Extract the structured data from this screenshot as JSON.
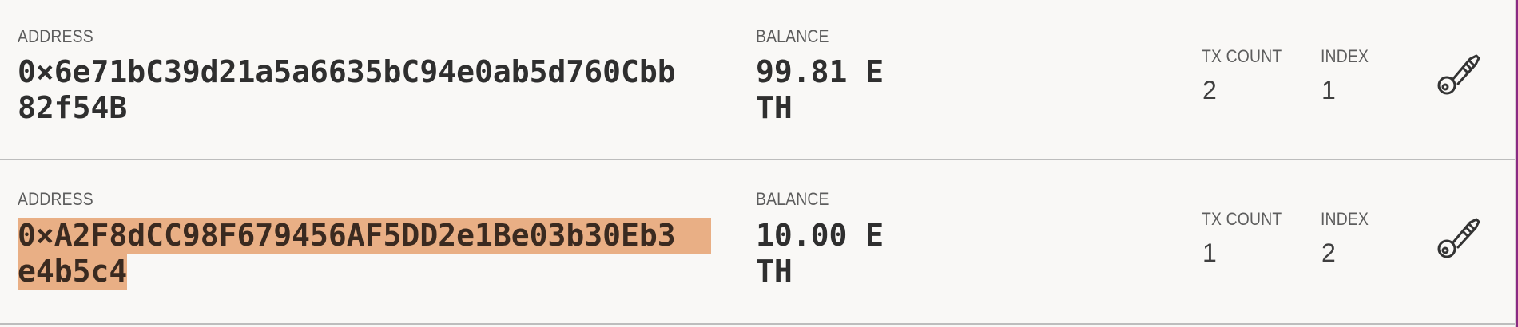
{
  "accounts": [
    {
      "address_label": "ADDRESS",
      "address_line1": "0×6e71bC39d21a5a6635bC94e0ab5d760Cbb",
      "address_line2": "82f54B",
      "balance_label": "BALANCE",
      "balance_line1": "99.81 E",
      "balance_line2": "TH",
      "tx_count_label": "TX COUNT",
      "tx_count": "2",
      "index_label": "INDEX",
      "index": "1",
      "key_icon": "key-icon",
      "selected": false
    },
    {
      "address_label": "ADDRESS",
      "address_line1": "0×A2F8dCC98F679456AF5DD2e1Be03b30Eb3",
      "address_line2": "e4b5c4",
      "balance_label": "BALANCE",
      "balance_line1": "10.00 E",
      "balance_line2": "TH",
      "tx_count_label": "TX COUNT",
      "tx_count": "1",
      "index_label": "INDEX",
      "index": "2",
      "key_icon": "key-icon",
      "selected": true
    }
  ],
  "colors": {
    "background": "#f9f8f6",
    "selection_highlight": "#e9af85",
    "divider": "#bdbdbd",
    "edge_accent": "#8a2a82"
  }
}
